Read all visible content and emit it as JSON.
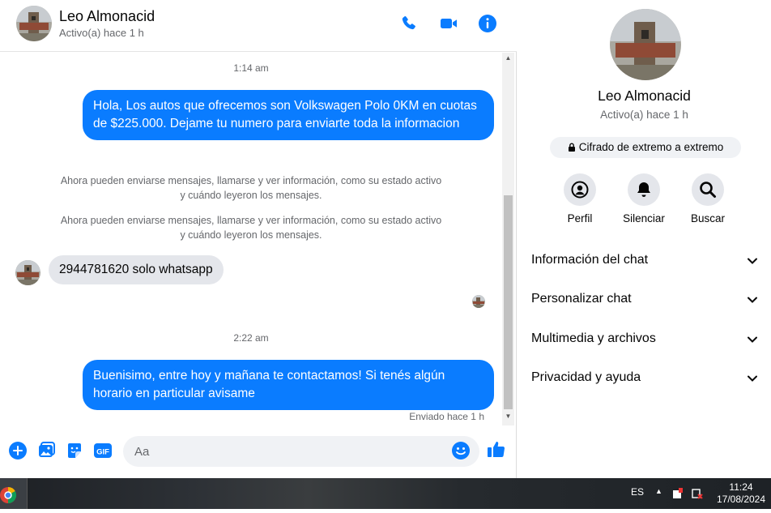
{
  "header": {
    "name": "Leo Almonacid",
    "status": "Activo(a) hace 1 h",
    "icons": [
      "phone-icon",
      "video-icon",
      "info-icon"
    ]
  },
  "messages": {
    "time1": "1:14 am",
    "out1": "Hola, Los autos que ofrecemos son Volkswagen Polo 0KM en cuotas de $225.000. Dejame tu numero para enviarte toda la informacion",
    "sys1": "Ahora pueden enviarse mensajes, llamarse y ver información, como su estado activo y cuándo leyeron los mensajes.",
    "sys2": "Ahora pueden enviarse mensajes, llamarse y ver información, como su estado activo y cuándo leyeron los mensajes.",
    "in1": "2944781620 solo whatsapp",
    "time2": "2:22 am",
    "out2": "Buenisimo, entre hoy y mañana te contactamos! Si tenés algún horario en particular avisame",
    "sent_status": "Enviado hace 1 h"
  },
  "composer": {
    "placeholder": "Aa",
    "icons": [
      "plus-icon",
      "image-icon",
      "sticker-icon",
      "gif-icon",
      "emoji-icon",
      "thumbs-up-icon"
    ]
  },
  "info": {
    "name": "Leo Almonacid",
    "status": "Activo(a) hace 1 h",
    "encryption": "Cifrado de extremo a extremo",
    "actions": [
      {
        "label": "Perfil",
        "icon": "profile-icon"
      },
      {
        "label": "Silenciar",
        "icon": "bell-icon"
      },
      {
        "label": "Buscar",
        "icon": "search-icon"
      }
    ],
    "sections": [
      {
        "label": "Información del chat"
      },
      {
        "label": "Personalizar chat"
      },
      {
        "label": "Multimedia y archivos"
      },
      {
        "label": "Privacidad y ayuda"
      }
    ]
  },
  "taskbar": {
    "lang": "ES",
    "time": "11:24",
    "date": "17/08/2024"
  },
  "colors": {
    "accent": "#0a7cff",
    "incoming_bubble": "#e4e6eb",
    "muted_text": "#65676b"
  }
}
